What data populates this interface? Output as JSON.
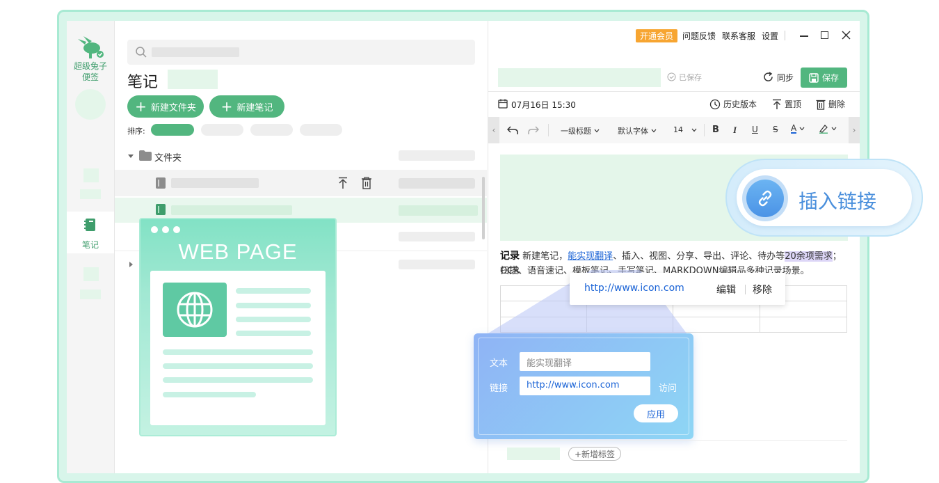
{
  "app": {
    "name_line1": "超级兔子",
    "name_line2": "便签",
    "rail_notes_label": "笔记"
  },
  "list": {
    "title": "笔记",
    "new_folder_label": "新建文件夹",
    "new_note_label": "新建笔记",
    "sort_label": "排序:",
    "folder_label": "文件夹"
  },
  "window": {
    "vip_label": "开通会员",
    "feedback_label": "问题反馈",
    "support_label": "联系客服",
    "settings_label": "设置"
  },
  "editor": {
    "saved_label": "已保存",
    "sync_label": "同步",
    "save_label": "保存",
    "datetime": "07月16日 15:30",
    "history_label": "历史版本",
    "pin_label": "置顶",
    "delete_label": "删除",
    "heading_select": "一级标题",
    "font_select": "默认字体",
    "size_select": "14",
    "para_bold": "记录",
    "para_t1": "新建笔记，",
    "para_link": "能实现翻译",
    "para_t2": "、插入、视图、分享、导出、评论、待办等",
    "para_highlight": "20余项需求",
    "para_t3": "；OCR",
    "para_line2": "扫描、语音速记、模板笔记、手写笔记、MARKDOWN编辑品多种记录场景。",
    "add_tag_label": "+新增标签"
  },
  "link_popup": {
    "url": "http://www.icon.com",
    "edit_label": "编辑",
    "remove_label": "移除"
  },
  "link_dialog": {
    "text_label": "文本",
    "text_value": "能实现翻译",
    "link_label": "链接",
    "link_value": "http://www.icon.com",
    "visit_label": "访问",
    "apply_label": "应用"
  },
  "callout": {
    "insert_link_label": "插入链接"
  },
  "web_page_card": {
    "title": "WEB PAGE"
  },
  "colors": {
    "brand_green": "#52b67f",
    "vip_orange": "#f7a531",
    "link_blue": "#1a63d6"
  }
}
